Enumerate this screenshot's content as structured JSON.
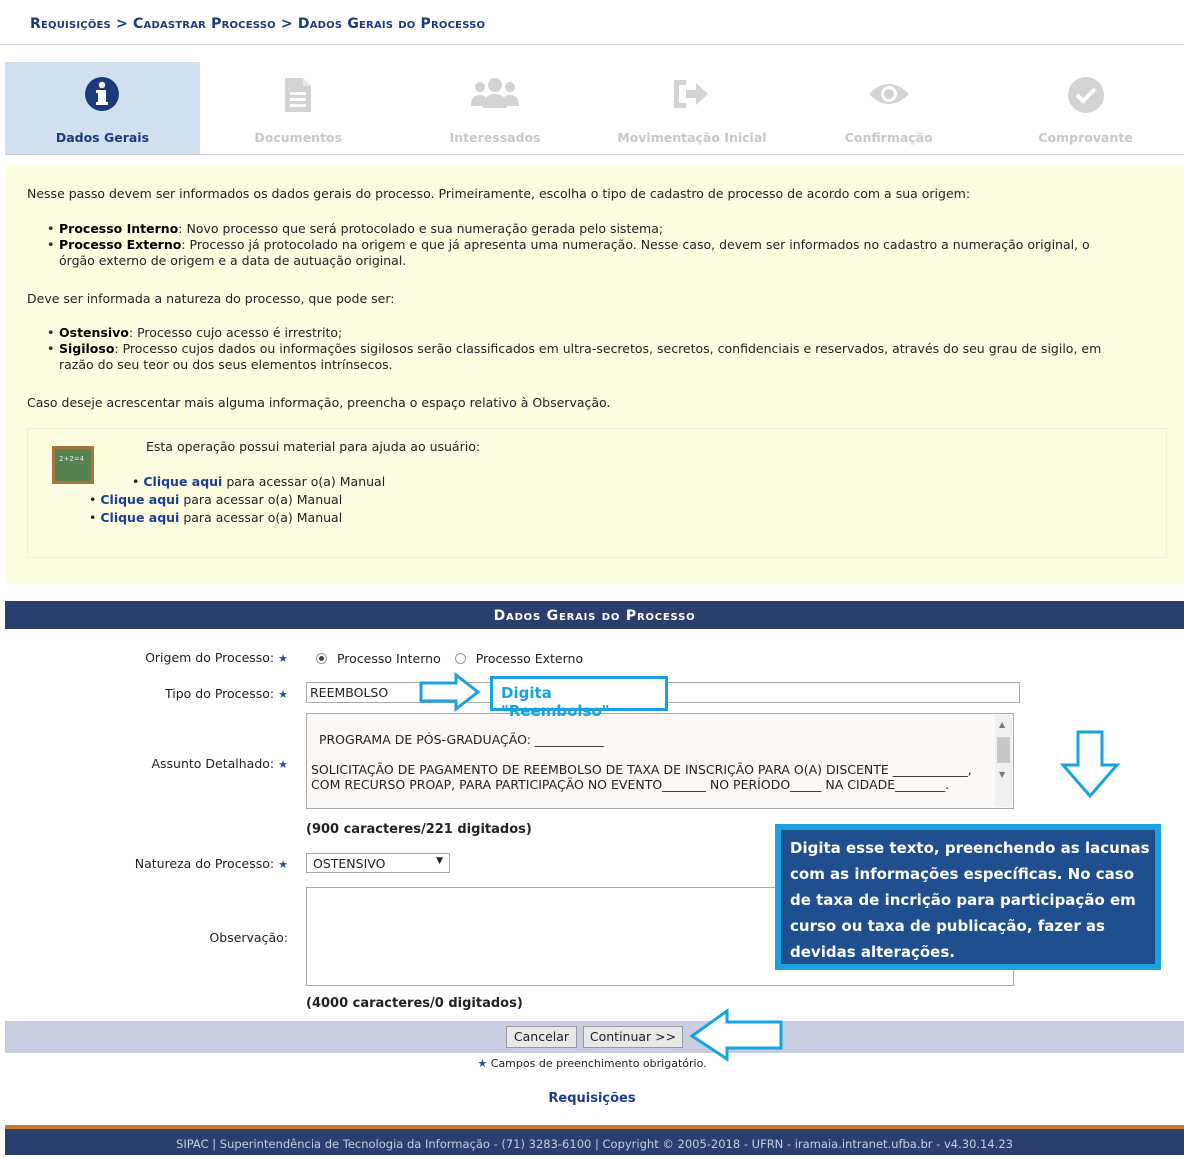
{
  "breadcrumb": "Requisições > Cadastrar Processo > Dados Gerais do Processo",
  "steps": [
    {
      "label": "Dados Gerais",
      "icon": "info-icon"
    },
    {
      "label": "Documentos",
      "icon": "document-icon"
    },
    {
      "label": "Interessados",
      "icon": "users-icon"
    },
    {
      "label": "Movimentação Inicial",
      "icon": "sign-in-icon"
    },
    {
      "label": "Confirmação",
      "icon": "eye-icon"
    },
    {
      "label": "Comprovante",
      "icon": "check-circle-icon"
    }
  ],
  "help": {
    "intro": "Nesse passo devem ser informados os dados gerais do processo. Primeiramente, escolha o tipo de cadastro de processo de acordo com a sua origem:",
    "origin_items": [
      {
        "term": "Processo Interno",
        "text": ": Novo processo que será protocolado e sua numeração gerada pelo sistema;"
      },
      {
        "term": "Processo Externo",
        "text": ": Processo já protocolado na origem e que já apresenta uma numeração. Nesse caso, devem ser informados no cadastro a numeração original, o órgão externo de origem e a data de autuação original."
      }
    ],
    "natureza_intro": "Deve ser informada a natureza do processo, que pode ser:",
    "natureza_items": [
      {
        "term": "Ostensivo",
        "text": ": Processo cujo acesso é irrestrito;"
      },
      {
        "term": "Sigiloso",
        "text": ": Processo cujos dados ou informações sigilosos serão classificados em ultra-secretos, secretos, confidenciais e reservados, através do seu grau de sigilo, em razão do seu teor ou dos seus elementos intrínsecos."
      }
    ],
    "obs_note": "Caso deseje acrescentar mais alguma informação, preencha o espaço relativo à Observação.",
    "manual_title": "Esta operação possui material para ajuda ao usuário:",
    "manual_link": "Clique aqui",
    "manual_text": " para acessar o(a) Manual",
    "chalkboard_text": "2+2=4"
  },
  "form": {
    "header": "Dados Gerais do Processo",
    "origem_label": "Origem do Processo:",
    "origem_interno": "Processo Interno",
    "origem_externo": "Processo Externo",
    "tipo_label": "Tipo do Processo:",
    "tipo_value": "REEMBOLSO",
    "assunto_label": "Assunto Detalhado:",
    "assunto_value": "PROGRAMA DE PÓS-GRADUAÇÃO: ___________\n\nSOLICITAÇÃO DE PAGAMENTO DE REEMBOLSO DE TAXA DE INSCRIÇÃO PARA O(A) DISCENTE ____________, COM RECURSO PROAP, PARA PARTICIPAÇÃO NO EVENTO_______ NO PERÍODO_____ NA CIDADE________.",
    "assunto_counter": "(900 caracteres/221 digitados)",
    "natureza_label": "Natureza do Processo:",
    "natureza_value": "OSTENSIVO",
    "obs_label": "Observação:",
    "obs_counter": "(4000 caracteres/0 digitados)",
    "cancel_label": "Cancelar",
    "continue_label": "Continuar >>",
    "required_note": "Campos de preenchimento obrigatório.",
    "requisicoes_link": "Requisições"
  },
  "annotations": {
    "reembolso_callout": "Digita \"Reembolso\"",
    "text_callout": "Digita esse texto, preenchendo as lacunas com as informações específicas. No caso de taxa de incrição para participação em curso ou taxa de publicação, fazer as devidas alterações."
  },
  "footer": "SIPAC | Superintendência de Tecnologia da Informação - (71) 3283-6100 | Copyright © 2005-2018 - UFRN - iramaia.intranet.ufba.br - v4.30.14.23",
  "colors": {
    "header_bg": "#2a3f6d",
    "accent": "#19a2e0",
    "link": "#1c3d92",
    "help_bg": "#fdfde0"
  }
}
